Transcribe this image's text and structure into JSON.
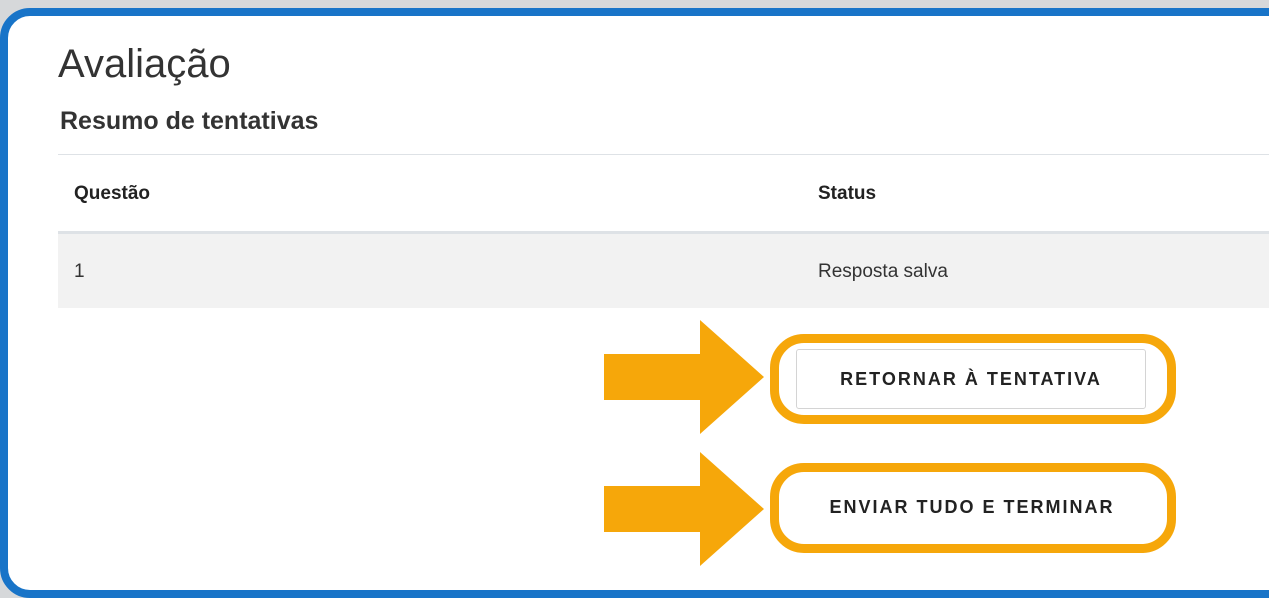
{
  "header": {
    "title": "Avaliação",
    "subtitle": "Resumo de tentativas"
  },
  "table": {
    "columns": [
      "Questão",
      "Status"
    ],
    "rows": [
      {
        "question": "1",
        "status": "Resposta salva"
      }
    ]
  },
  "actions": {
    "return_label": "RETORNAR À TENTATIVA",
    "submit_label": "ENVIAR TUDO E TERMINAR"
  },
  "colors": {
    "frame_border": "#1874c8",
    "highlight": "#f6a70a"
  },
  "icons": {
    "callout_arrow": "arrow-right-icon"
  }
}
